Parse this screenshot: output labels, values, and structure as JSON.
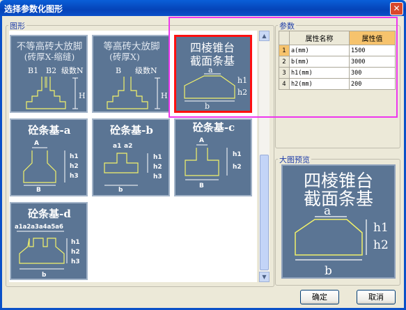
{
  "window": {
    "title": "选择参数化图形",
    "close_glyph": "✕"
  },
  "shapes_group": {
    "title": "图形",
    "tiles": [
      {
        "line1": "不等高砖大放脚",
        "line2": "(砖厚X-缩缝)",
        "labels": [
          "B1",
          "B2",
          "级数N",
          "H"
        ]
      },
      {
        "line1": "等高砖大放脚",
        "line2": "(砖厚X)",
        "labels": [
          "B",
          "级数N",
          "H"
        ]
      },
      {
        "line1": "四棱锥台",
        "line2": "截面条基",
        "labels": [
          "a",
          "h1",
          "h2",
          "b"
        ]
      },
      {
        "line1": "砼条基-a",
        "labels": [
          "A",
          "h1",
          "h2",
          "h3",
          "B"
        ]
      },
      {
        "line1": "砼条基-b",
        "labels": [
          "a1",
          "a2",
          "h1",
          "h2",
          "h3",
          "b"
        ]
      },
      {
        "line1": "砼条基-c",
        "labels": [
          "A",
          "h1",
          "h2",
          "B"
        ]
      },
      {
        "line1": "砼条基-d",
        "labels": [
          "a1a2a3a4a5a6",
          "h1",
          "h2",
          "h3",
          "b"
        ]
      }
    ]
  },
  "params_group": {
    "title": "参数",
    "headers": [
      "属性名称",
      "属性值"
    ],
    "rows": [
      {
        "idx": "1",
        "name": "a(mm)",
        "value": "1500"
      },
      {
        "idx": "2",
        "name": "b(mm)",
        "value": "3000"
      },
      {
        "idx": "3",
        "name": "h1(mm)",
        "value": "300"
      },
      {
        "idx": "4",
        "name": "h2(mm)",
        "value": "200"
      }
    ]
  },
  "preview_group": {
    "title": "大图预览",
    "line1": "四棱锥台",
    "line2": "截面条基",
    "labels": [
      "a",
      "h1",
      "h2",
      "b"
    ]
  },
  "buttons": {
    "ok": "确定",
    "cancel": "取消"
  },
  "colors": {
    "tile_bg": "#5b7594",
    "shape_line": "#f2f26a",
    "selected_border": "#ff1010",
    "annotation": "#ee36ee"
  }
}
